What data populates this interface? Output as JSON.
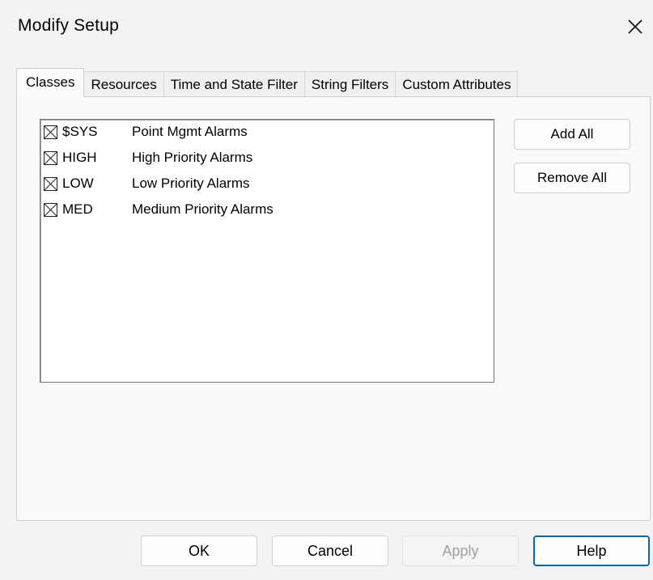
{
  "window": {
    "title": "Modify Setup",
    "close_icon": "close-icon"
  },
  "tabs": [
    {
      "label": "Classes",
      "active": true
    },
    {
      "label": "Resources",
      "active": false
    },
    {
      "label": "Time and State Filter",
      "active": false
    },
    {
      "label": "String Filters",
      "active": false
    },
    {
      "label": "Custom Attributes",
      "active": false
    }
  ],
  "classes": {
    "items": [
      {
        "code": "$SYS",
        "description": "Point Mgmt Alarms",
        "checked": true
      },
      {
        "code": "HIGH",
        "description": "High Priority Alarms",
        "checked": true
      },
      {
        "code": "LOW",
        "description": "Low Priority Alarms",
        "checked": true
      },
      {
        "code": "MED",
        "description": "Medium Priority Alarms",
        "checked": true
      }
    ],
    "add_all_label": "Add All",
    "remove_all_label": "Remove All"
  },
  "buttons": {
    "ok": "OK",
    "cancel": "Cancel",
    "apply": "Apply",
    "help": "Help"
  },
  "colors": {
    "default_button_border": "#0067c0",
    "disabled_text": "#a0a0a0"
  }
}
